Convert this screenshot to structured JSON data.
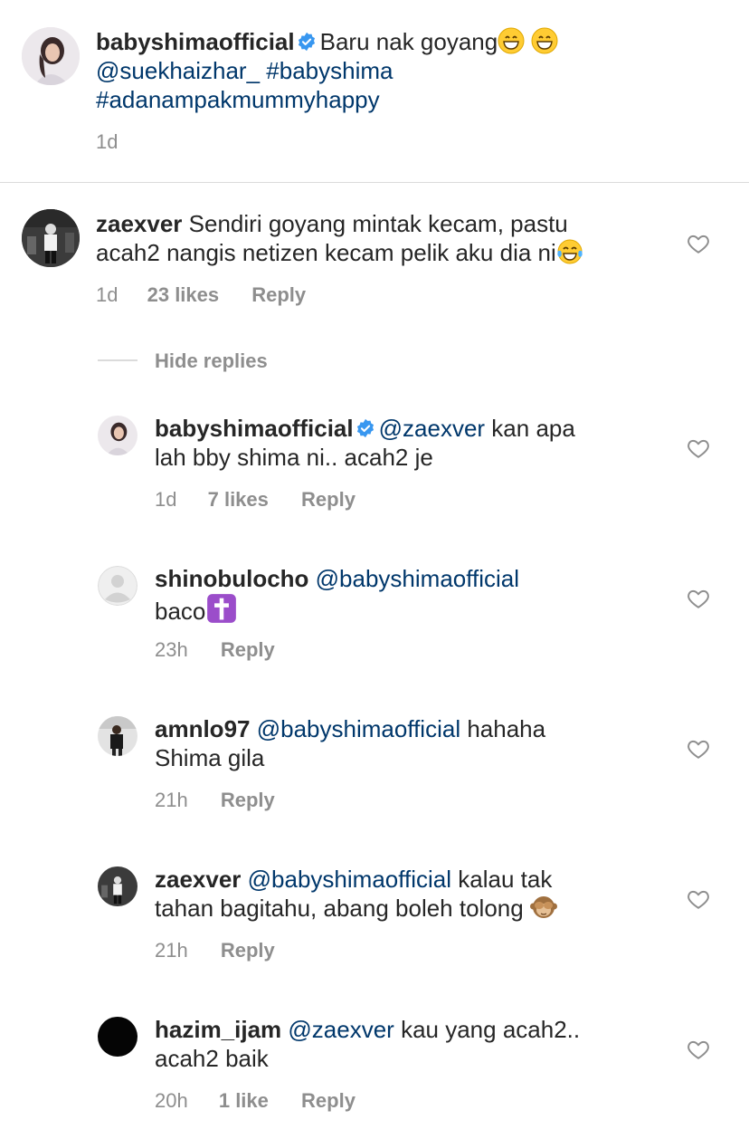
{
  "post": {
    "username": "babyshimaofficial",
    "caption_text": "Baru nak goyang",
    "mention": "@suekhaizhar_",
    "hashtag1": "#babyshima",
    "hashtag2": "#adanampakmummyhappy",
    "time": "1d"
  },
  "comments": [
    {
      "username": "zaexver",
      "line1": "Sendiri goyang mintak kecam, pastu",
      "line2": "acah2 nangis netizen kecam pelik aku dia ni",
      "time": "1d",
      "likes": "23 likes",
      "reply": "Reply"
    }
  ],
  "hide_replies": "Hide replies",
  "replies": [
    {
      "username": "babyshimaofficial",
      "mention": "@zaexver",
      "line1_rest": "kan apa",
      "line2": "lah bby shima ni.. acah2 je",
      "time": "1d",
      "likes": "7 likes",
      "reply": "Reply"
    },
    {
      "username": "shinobulocho",
      "mention": "@babyshimaofficial",
      "line2": "baco",
      "time": "23h",
      "reply": "Reply"
    },
    {
      "username": "amnlo97",
      "mention": "@babyshimaofficial",
      "line1_rest": "hahaha",
      "line2": "Shima gila",
      "time": "21h",
      "reply": "Reply"
    },
    {
      "username": "zaexver",
      "mention": "@babyshimaofficial",
      "line1_rest": "kalau tak",
      "line2": "tahan bagitahu, abang boleh tolong",
      "time": "21h",
      "reply": "Reply"
    },
    {
      "username": "hazim_ijam",
      "mention": "@zaexver",
      "line1_rest": "kau yang acah2..",
      "line2": "acah2 baik",
      "time": "20h",
      "likes": "1 like",
      "reply": "Reply"
    }
  ],
  "colors": {
    "text": "#262626",
    "link": "#00376b",
    "meta": "#8e8e8e",
    "verified": "#3897f0",
    "divider": "#dbdbdb"
  },
  "icons": {
    "heart": "heart-outline-icon",
    "verified": "verified-badge-icon"
  }
}
